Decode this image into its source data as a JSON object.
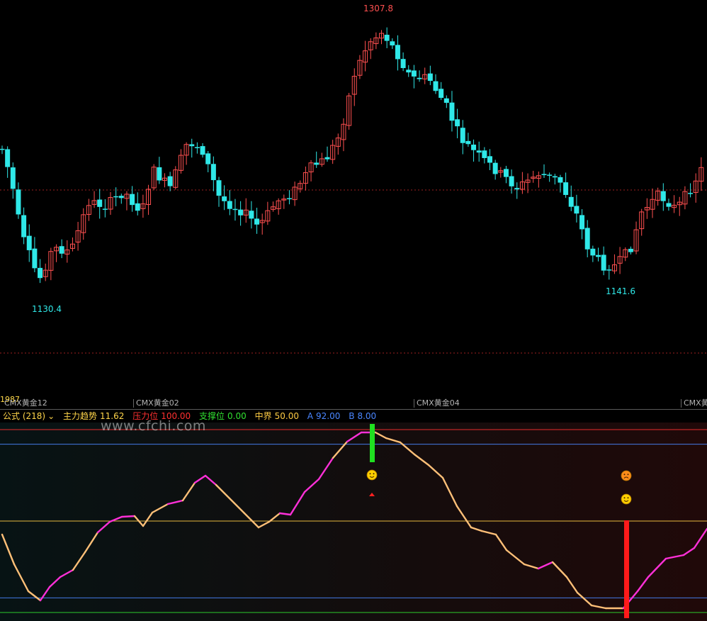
{
  "price_chart": {
    "high_label": "1307.8",
    "low_label_left": "1130.4",
    "low_label_right": "1141.6",
    "up_color": "#ff5050",
    "down_color": "#2fe8e8",
    "ref_line_color": "#9c1f1f"
  },
  "time_axis": {
    "number": "1987",
    "labels": [
      "CMX黄金12",
      "CMX黄金02",
      "CMX黄金04",
      "CMX黄金"
    ]
  },
  "indicator_header": {
    "formula": "公式 (218)",
    "dropdown_icon": "chevron-down-icon",
    "trend_label": "主力趋势",
    "trend_value": "11.62",
    "pressure_label": "压力位",
    "pressure_value": "100.00",
    "support_label": "支撑位",
    "support_value": "0.00",
    "mid_label": "中界",
    "mid_value": "50.00",
    "a_label": "A",
    "a_value": "92.00",
    "b_label": "B",
    "b_value": "8.00"
  },
  "watermark": "www.cfchi.com",
  "colors": {
    "formula": "#ffd54a",
    "trend": "#ffd54a",
    "pressure": "#ff3030",
    "support": "#30e030",
    "mid": "#ffcc44",
    "ab": "#4a86ff",
    "line_normal": "#ffc078",
    "line_rising": "#ff30d8"
  },
  "chart_data": [
    {
      "type": "candlestick",
      "title": "",
      "low": 1130.4,
      "high": 1307.8,
      "annotations": [
        "1307.8",
        "1130.4",
        "1141.6"
      ]
    },
    {
      "type": "line",
      "title": "",
      "ylim": [
        0,
        100
      ],
      "reference_lines": {
        "pressure": 100,
        "support": 0,
        "mid": 50,
        "A": 92,
        "B": 8
      },
      "last_value": 11.62,
      "signals": [
        "sell-bar-top",
        "buy-bar-bottom"
      ]
    }
  ]
}
